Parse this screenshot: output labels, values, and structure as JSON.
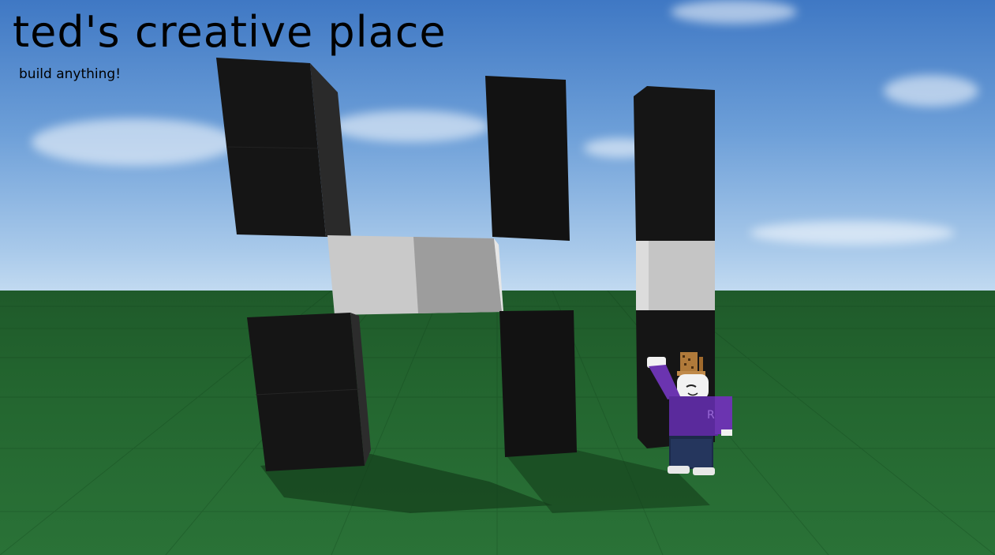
{
  "game": {
    "title": "ted's creative place",
    "subtitle": "build anything!"
  },
  "scene": {
    "sky_color": "#6d9fd8",
    "ground_color": "#23652f",
    "brick_dark_color": "#111111",
    "brick_light_color": "#c8c8c8"
  },
  "avatar": {
    "shirt_color": "#5a2a9c",
    "shirt_text": "RO",
    "hat": "wooden-chair-hat"
  }
}
